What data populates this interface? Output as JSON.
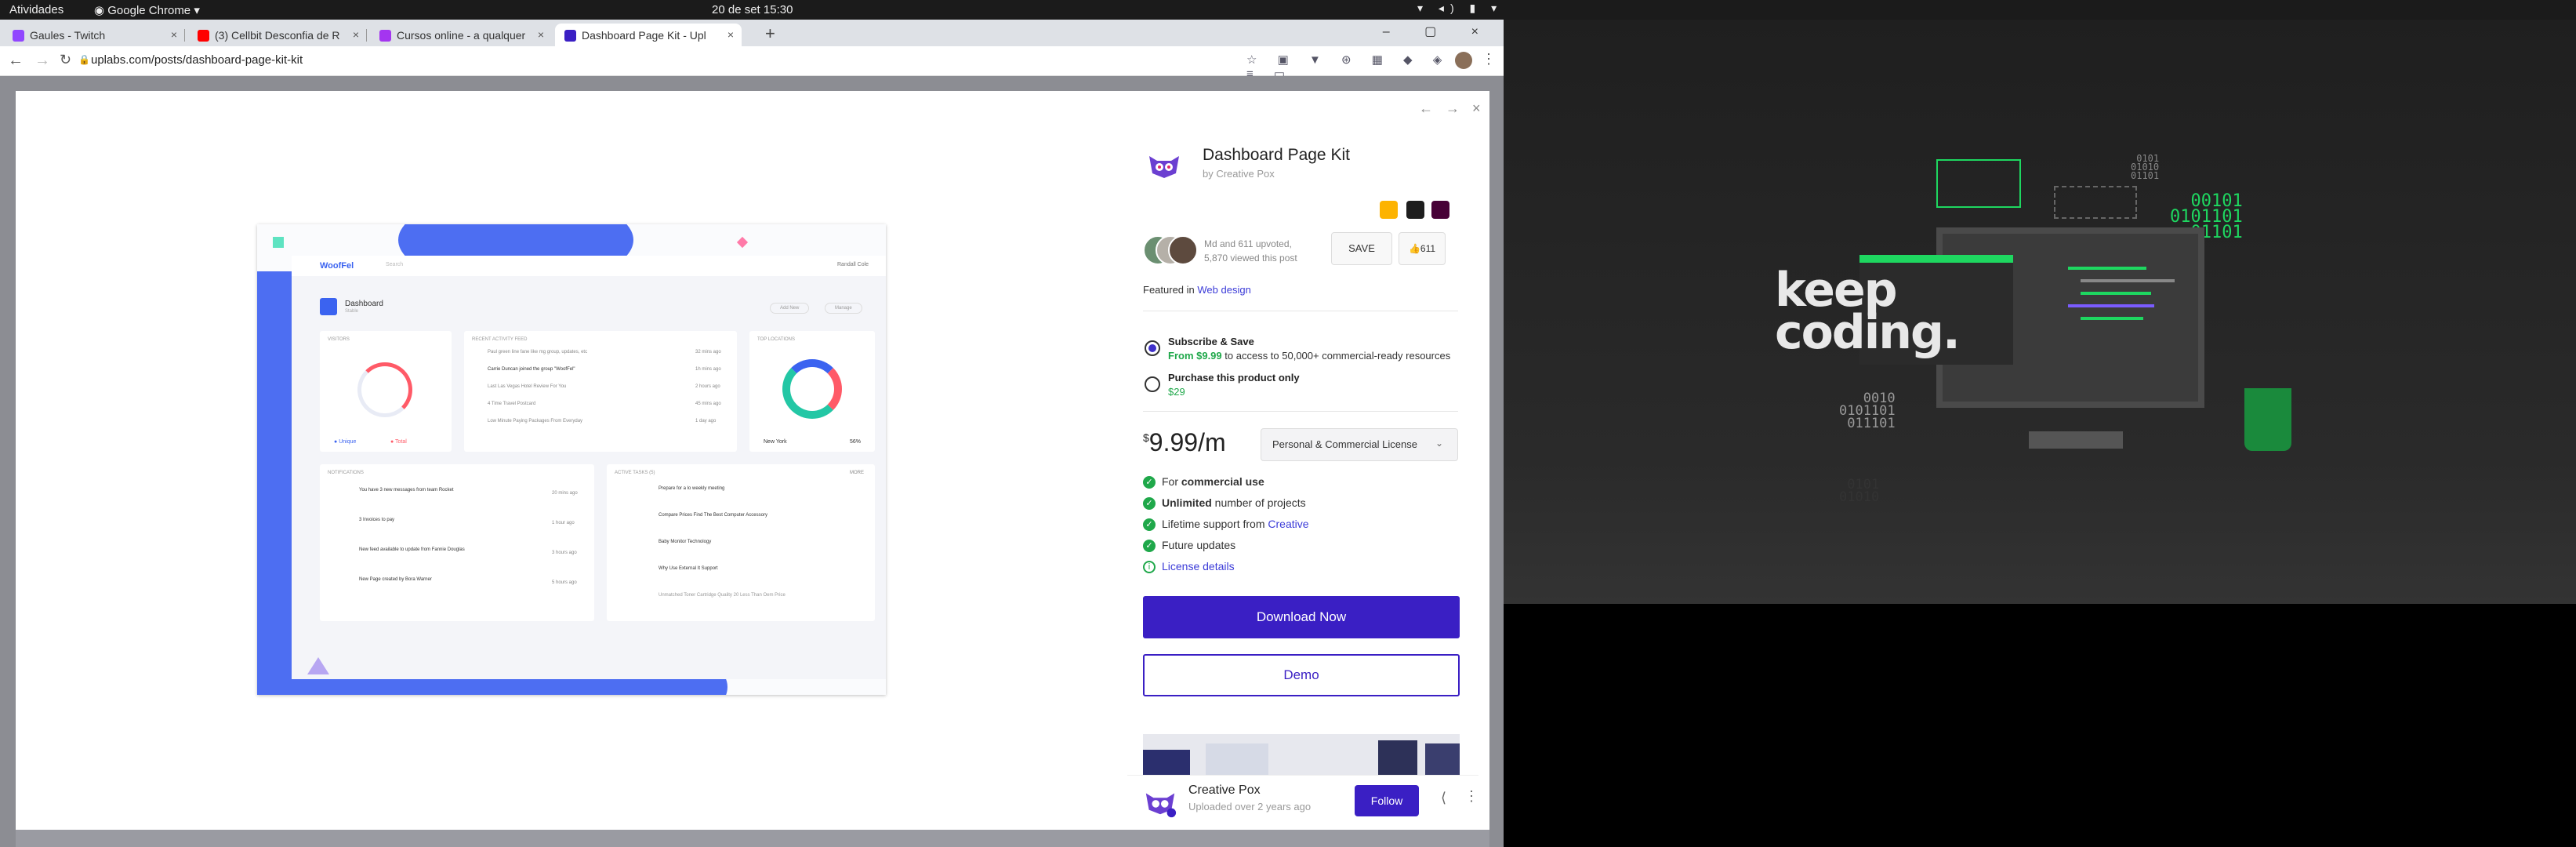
{
  "system_bar": {
    "activities": "Atividades",
    "app": "Google Chrome",
    "clock": "20 de set  15:30"
  },
  "tabs": [
    {
      "label": "Gaules - Twitch",
      "fav_color": "#9146ff"
    },
    {
      "label": "(3) Cellbit Desconfia de R",
      "fav_color": "#ff0000"
    },
    {
      "label": "Cursos online - a qualquer",
      "fav_color": "#a435f0"
    },
    {
      "label": "Dashboard Page Kit - Upl",
      "fav_color": "#3a1fc4"
    }
  ],
  "address": {
    "url": "uplabs.com/posts/dashboard-page-kit-kit"
  },
  "mockup": {
    "brand": "WoofFel",
    "search": "Search",
    "user": "Randall Cole",
    "page_title": "Dashboard",
    "page_sub": "Stable",
    "btn_add": "Add New",
    "btn_manage": "Manage",
    "card_visitors": "VISITORS",
    "card_activity": "RECENT ACTIVITY FEED",
    "card_locations": "TOP LOCATIONS",
    "card_notifications": "NOTIFICATIONS",
    "card_active": "ACTIVE TASKS (5)",
    "card_more": "MORE",
    "legend_unique": "Unique",
    "legend_total": "Total",
    "location": "New York",
    "location_pct": "56%",
    "feed": [
      "Paul green line fane like mg group, updates, etc",
      "Carrie Duncan joined the group \"WoofFel\"",
      "Last Las Vegas Hotel Review For You",
      "4 Time Travel Postcard",
      "Low Minute Paying Packages From Everyday"
    ],
    "feed_times": [
      "32 mins ago",
      "1h mins ago",
      "2 hours ago",
      "45 mins ago",
      "1 day ago"
    ],
    "notifications": [
      "You have 3 new messages from team Rocket",
      "3 Invoices to pay",
      "New feed available to update from Fannie Douglas",
      "New Page created by Bora Warner"
    ],
    "notification_times": [
      "20 mins ago",
      "1 hour ago",
      "3 hours ago",
      "5 hours ago"
    ],
    "tasks": [
      "Prepare for a lo weekly meeting",
      "Compare Prices Find The Best Computer Accessory",
      "Baby Monitor Technology",
      "Why Use External It Support",
      "Unmatched Toner Cartridge Quality 20 Less Than Oem Price"
    ]
  },
  "panel": {
    "title": "Dashboard Page Kit",
    "byline": "by Creative Pox",
    "upvotes_line": "Md and 611 upvoted,",
    "views_line": "5,870 viewed this post",
    "save": "SAVE",
    "likes": "611",
    "featured_prefix": "Featured in",
    "featured_link": "Web design",
    "opt1_title": "Subscribe & Save",
    "opt1_price": "From $9.99",
    "opt1_rest": "to access to 50,000+ commercial-ready resources",
    "opt2_title": "Purchase this product only",
    "opt2_price": "$29",
    "price_sym": "$",
    "price_val": "9.99/m",
    "license": "Personal & Commercial License",
    "features": [
      {
        "pre": "For ",
        "bold": "commercial use",
        "post": ""
      },
      {
        "pre": "",
        "bold": "Unlimited",
        "post": " number of projects"
      },
      {
        "pre": "Lifetime support from ",
        "bold": "",
        "post": "",
        "link": "Creative"
      },
      {
        "pre": "Future updates",
        "bold": "",
        "post": ""
      }
    ],
    "license_details": "License details",
    "download": "Download Now",
    "demo": "Demo"
  },
  "footer": {
    "name": "Creative Pox",
    "uploaded": "Uploaded over 2 years ago",
    "follow": "Follow"
  },
  "wallpaper": {
    "keep": "keep",
    "coding": "coding.",
    "bin1": "0101\n01010\n01101",
    "bin2": "00101\n0101101\n01101",
    "bin3": "0010\n0101101\n011101",
    "bin4": "0101\n01010"
  }
}
